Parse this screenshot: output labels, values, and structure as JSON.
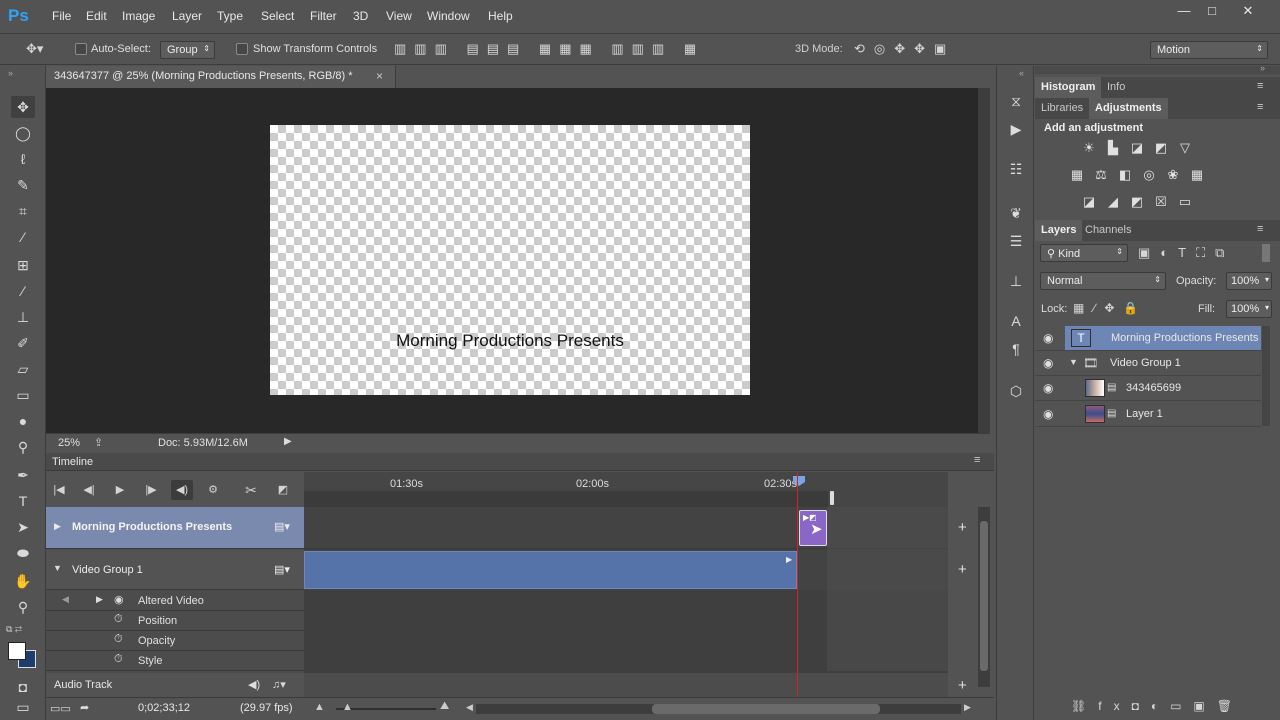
{
  "app": {
    "logo": "Ps"
  },
  "menu": [
    "File",
    "Edit",
    "Image",
    "Layer",
    "Type",
    "Select",
    "Filter",
    "3D",
    "View",
    "Window",
    "Help"
  ],
  "window_controls": {
    "minimize": "—",
    "maximize": "□",
    "close": "✕"
  },
  "options": {
    "auto_select_label": "Auto-Select:",
    "auto_select_value": "Group",
    "transform_label": "Show Transform Controls",
    "mode3d_label": "3D Mode:",
    "workspace": "Motion"
  },
  "document": {
    "tab_title": "343647377 @ 25% (Morning Productions Presents, RGB/8) *",
    "close": "×",
    "canvas_text": "Morning Productions Presents",
    "zoom": "25%",
    "doc_size": "Doc: 5.93M/12.6M"
  },
  "timeline": {
    "title": "Timeline",
    "ruler_labels": [
      "01:30s",
      "02:00s",
      "02:30s"
    ],
    "tracks": [
      {
        "name": "Morning Productions Presents"
      },
      {
        "name": "Video Group 1"
      }
    ],
    "properties": [
      "Altered Video",
      "Position",
      "Opacity",
      "Style"
    ],
    "audio_track": "Audio Track",
    "timecode": "0;02;33;12",
    "fps": "(29.97 fps)"
  },
  "panels": {
    "histogram_tab": "Histogram",
    "info_tab": "Info",
    "libraries_tab": "Libraries",
    "adjustments_tab": "Adjustments",
    "add_adjustment": "Add an adjustment",
    "layers_tab": "Layers",
    "channels_tab": "Channels",
    "kind_filter": "Kind",
    "blend_mode": "Normal",
    "opacity_label": "Opacity:",
    "opacity_value": "100%",
    "lock_label": "Lock:",
    "fill_label": "Fill:",
    "fill_value": "100%"
  },
  "layers": [
    {
      "name": "Morning Productions Presents",
      "type": "text",
      "selected": true
    },
    {
      "name": "Video Group 1",
      "type": "group",
      "selected": false
    },
    {
      "name": "343465699",
      "type": "video",
      "selected": false
    },
    {
      "name": "Layer 1",
      "type": "video",
      "selected": false
    }
  ],
  "colors": {
    "accent": "#2fa3f6",
    "selected_track": "#7a8aaf",
    "clip_blue": "#5573a8",
    "clip_purple": "#8a66c6",
    "playhead": "#c82828",
    "layer_selected": "#6e86b5"
  }
}
